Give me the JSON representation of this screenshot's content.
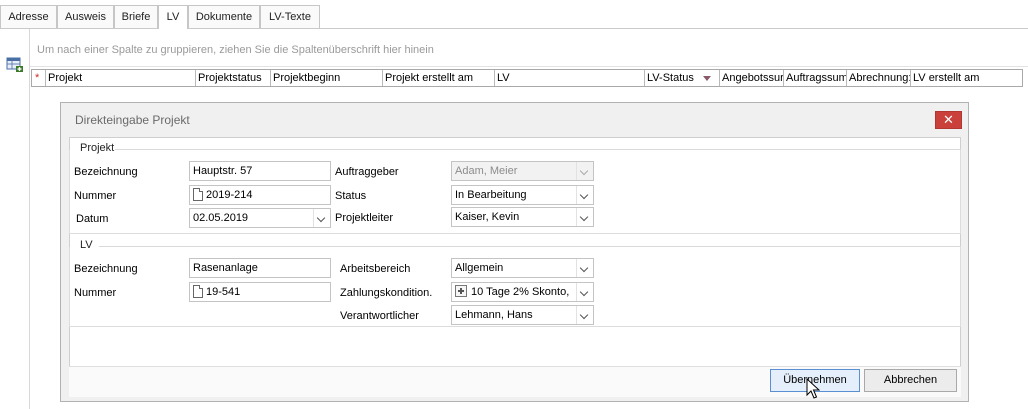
{
  "tabs": [
    "Adresse",
    "Ausweis",
    "Briefe",
    "LV",
    "Dokumente",
    "LV-Texte"
  ],
  "active_tab": "LV",
  "grid": {
    "group_hint": "Um nach einer Spalte zu gruppieren, ziehen Sie die Spaltenüberschrift hier hinein",
    "new_row_marker": "*",
    "columns": [
      "Projekt",
      "Projektstatus",
      "Projektbeginn",
      "Projekt erstellt am",
      "LV",
      "LV-Status",
      "Angebotssur",
      "Auftragssum",
      "Abrechnung:",
      "LV erstellt am"
    ]
  },
  "dialog": {
    "title": "Direkteingabe Projekt",
    "close_label": "✕",
    "projekt": {
      "section_title": "Projekt",
      "bezeichnung_label": "Bezeichnung",
      "bezeichnung_value": "Hauptstr. 57",
      "nummer_label": "Nummer",
      "nummer_value": "2019-214",
      "datum_label": "Datum",
      "datum_value": "02.05.2019",
      "auftraggeber_label": "Auftraggeber",
      "auftraggeber_value": "Adam, Meier",
      "status_label": "Status",
      "status_value": "In Bearbeitung",
      "projektleiter_label": "Projektleiter",
      "projektleiter_value": "Kaiser, Kevin"
    },
    "lv": {
      "section_title": "LV",
      "bezeichnung_label": "Bezeichnung",
      "bezeichnung_value": "Rasenanlage",
      "nummer_label": "Nummer",
      "nummer_value": "19-541",
      "arbeitsbereich_label": "Arbeitsbereich",
      "arbeitsbereich_value": "Allgemein",
      "zahlungskondition_label": "Zahlungskondition.",
      "zahlungskondition_value": "10 Tage 2% Skonto,",
      "verantwortlicher_label": "Verantwortlicher",
      "verantwortlicher_value": "Lehmann, Hans"
    },
    "buttons": {
      "apply": "Übernehmen",
      "cancel": "Abbrechen"
    }
  },
  "colors": {
    "close_button": "#c9413a",
    "primary_button_border": "#5a8fd2"
  }
}
